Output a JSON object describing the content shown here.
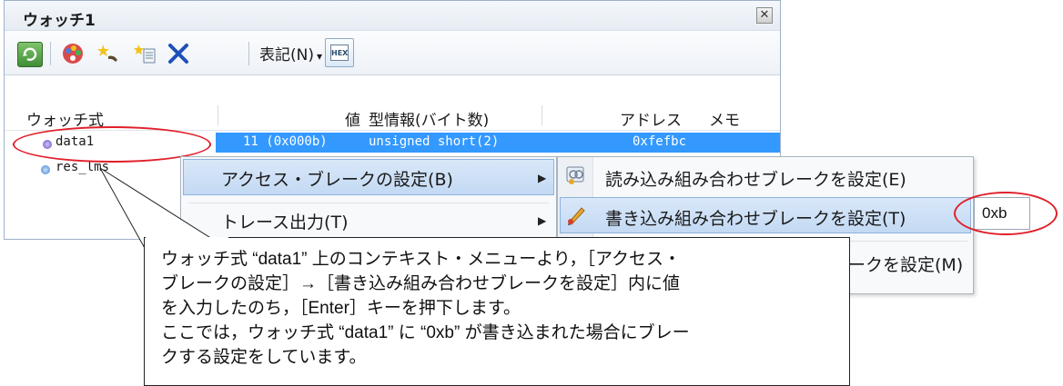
{
  "window": {
    "title": "ウォッチ1",
    "close_glyph": "✕"
  },
  "toolbar": {
    "icons": [
      "refresh-icon",
      "color-palette-icon",
      "add-watch-icon",
      "add-item-icon",
      "delete-icon"
    ],
    "notation_label": "表記(N)",
    "notation_arrow": "▾",
    "hex_label": "HEX"
  },
  "columns": {
    "expression": "ウォッチ式",
    "value": "値",
    "type": "型情報(バイト数)",
    "address": "アドレス",
    "memo": "メモ"
  },
  "rows": [
    {
      "name": "data1",
      "value": "11 (0x000b)",
      "type": "unsigned short(2)",
      "address": "0xfefbc"
    },
    {
      "name": "res_lms"
    }
  ],
  "context_menu": {
    "items": [
      {
        "label": "アクセス・ブレークの設定(B)",
        "arrow": "▶"
      },
      {
        "label": "トレース出力(T)",
        "arrow": "▶"
      }
    ]
  },
  "submenu": {
    "items": [
      {
        "label": "読み込み組み合わせブレークを設定(E)",
        "icon": "read-break-icon"
      },
      {
        "label": "書き込み組み合わせブレークを設定(T)",
        "icon": "write-break-icon"
      },
      {
        "label": "ークを設定(M)"
      }
    ],
    "input_value": "0xb"
  },
  "callout": {
    "text": "ウォッチ式 “data1” 上のコンテキスト・メニューより，［アクセス・\nブレークの設定］→［書き込み組み合わせブレークを設定］内に値\nを入力したのち，［Enter］キーを押下します。\nここでは，ウォッチ式 “data1” に “0xb” が書き込まれた場合にブレー\nクする設定をしています。"
  },
  "colors": {
    "selection": "#3399ff",
    "annotation_red": "#e0202a",
    "menu_highlight": "#c3d9f3"
  }
}
